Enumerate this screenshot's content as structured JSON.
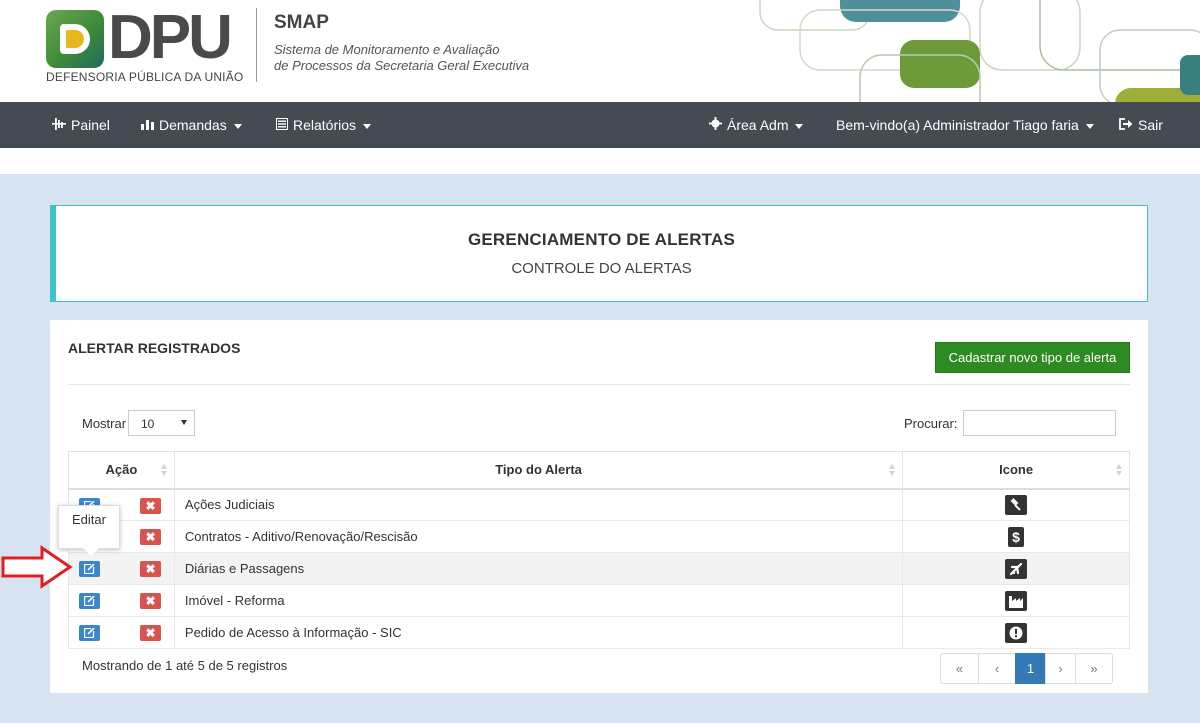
{
  "header": {
    "logo_letters": "DPU",
    "logo_subtitle": "DEFENSORIA PÚBLICA DA UNIÃO",
    "app_name": "SMAP",
    "app_desc_line1": "Sistema de Monitoramento e Avaliação",
    "app_desc_line2": "de Processos da Secretaria Geral Executiva"
  },
  "navbar": {
    "painel": "Painel",
    "demandas": "Demandas",
    "relatorios": "Relatórios",
    "area_adm": "Área Adm",
    "user": "Bem-vindo(a) Administrador Tiago faria",
    "sair": "Sair"
  },
  "title_panel": {
    "title": "GERENCIAMENTO DE ALERTAS",
    "subtitle": "CONTROLE DO ALERTAS"
  },
  "main": {
    "panel_title": "ALERTAR REGISTRADOS",
    "new_button": "Cadastrar novo tipo de alerta",
    "length_label": "Mostrar",
    "length_value": "10",
    "search_label": "Procurar:",
    "search_value": "",
    "columns": [
      "Ação",
      "Tipo do Alerta",
      "Icone"
    ],
    "rows": [
      {
        "tipo": "Ações Judiciais",
        "icon": "gavel-icon"
      },
      {
        "tipo": "Contratos - Aditivo/Renovação/Rescisão",
        "icon": "dollar-icon"
      },
      {
        "tipo": "Diárias e Passagens",
        "icon": "plane-icon"
      },
      {
        "tipo": "Imóvel - Reforma",
        "icon": "industry-icon"
      },
      {
        "tipo": "Pedido de Acesso à Informação - SIC",
        "icon": "exclamation-circle-icon"
      }
    ],
    "delete_glyph": "✖",
    "info": "Mostrando de 1 até 5 de 5 registros",
    "pager": {
      "first": "«",
      "prev": "‹",
      "current": "1",
      "next": "›",
      "last": "»"
    }
  },
  "tooltip": {
    "text": "Editar"
  },
  "colors": {
    "navbar": "#444b53",
    "accent_teal": "#3fc1c9",
    "button_green": "#2e8b22",
    "edit_blue": "#3a87c8",
    "delete_red": "#d9534f",
    "page_active": "#337ab7",
    "annotation_arrow": "#e02020"
  }
}
